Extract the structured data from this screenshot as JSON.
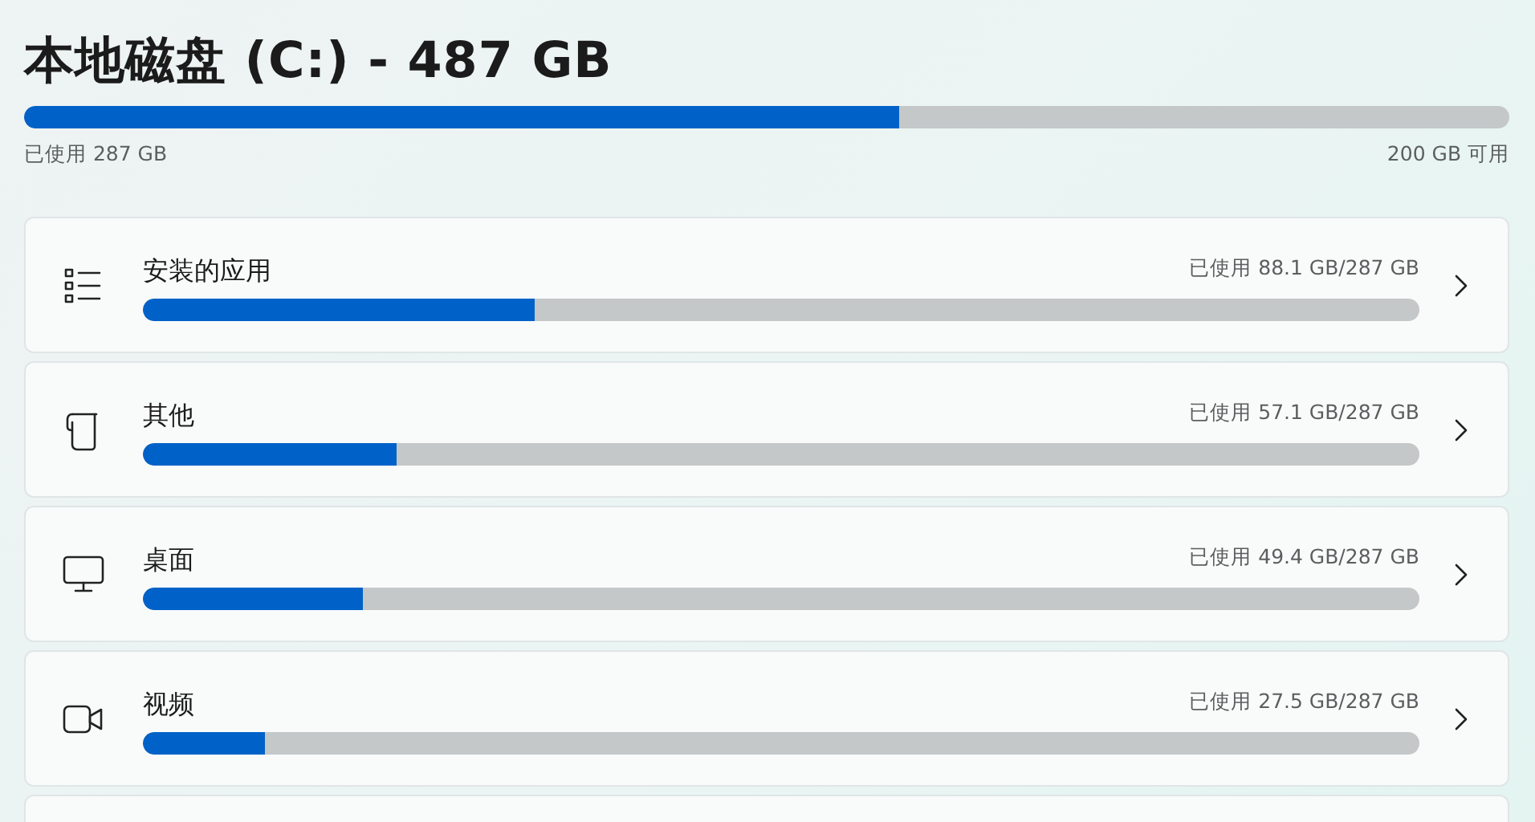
{
  "title": "本地磁盘 (C:) - 487 GB",
  "usage": {
    "level": 0.589,
    "used": "已使用 287 GB",
    "free": "200 GB 可用"
  },
  "categories": [
    {
      "name": "安装的应用",
      "reading": "已使用 88.1 GB/287 GB",
      "level": 0.307
    },
    {
      "name": "其他",
      "reading": "已使用 57.1 GB/287 GB",
      "level": 0.199
    },
    {
      "name": "桌面",
      "reading": "已使用 49.4 GB/287 GB",
      "level": 0.172
    },
    {
      "name": "视频",
      "reading": "已使用 27.5 GB/287 GB",
      "level": 0.096
    }
  ]
}
